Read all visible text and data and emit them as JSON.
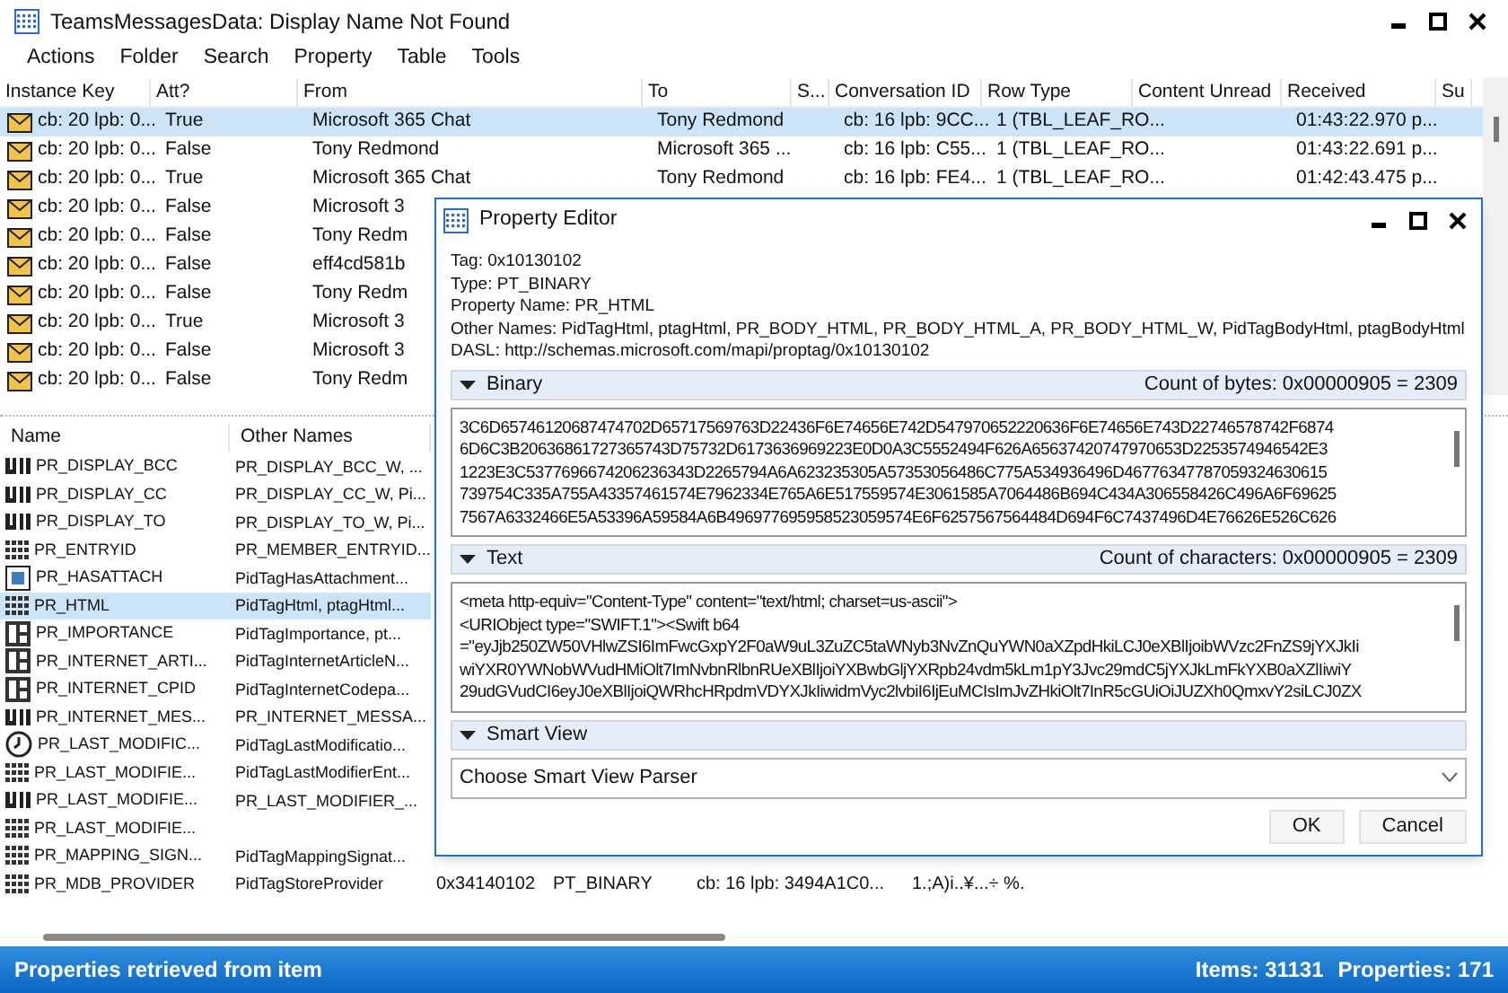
{
  "window": {
    "title": "TeamsMessagesData: Display Name Not Found"
  },
  "menu": [
    "Actions",
    "Folder",
    "Search",
    "Property",
    "Table",
    "Tools"
  ],
  "messages_table": {
    "columns": [
      "Instance Key",
      "Att?",
      "From",
      "To",
      "S...",
      "Conversation ID",
      "Row Type",
      "Content Unread",
      "Received",
      "Su"
    ],
    "rows": [
      {
        "selected": true,
        "instance_key": "cb: 20 lpb: 0...",
        "attachment": "True",
        "from": "Microsoft 365 Chat",
        "to": "Tony Redmond",
        "conversation_id": "cb: 16 lpb: 9CC...",
        "row_type": "1 (TBL_LEAF_RO...",
        "received": "01:43:22.970 p..."
      },
      {
        "selected": false,
        "instance_key": "cb: 20 lpb: 0...",
        "attachment": "False",
        "from": "Tony Redmond",
        "to": "Microsoft 365 ...",
        "conversation_id": "cb: 16 lpb: C55...",
        "row_type": "1 (TBL_LEAF_RO...",
        "received": "01:43:22.691 p..."
      },
      {
        "selected": false,
        "instance_key": "cb: 20 lpb: 0...",
        "attachment": "True",
        "from": "Microsoft 365 Chat",
        "to": "Tony Redmond",
        "conversation_id": "cb: 16 lpb: FE4...",
        "row_type": "1 (TBL_LEAF_RO...",
        "received": "01:42:43.475 p..."
      },
      {
        "selected": false,
        "instance_key": "cb: 20 lpb: 0...",
        "attachment": "False",
        "from": "Microsoft 3"
      },
      {
        "selected": false,
        "instance_key": "cb: 20 lpb: 0...",
        "attachment": "False",
        "from": "Tony Redm"
      },
      {
        "selected": false,
        "instance_key": "cb: 20 lpb: 0...",
        "attachment": "False",
        "from": "eff4cd581b"
      },
      {
        "selected": false,
        "instance_key": "cb: 20 lpb: 0...",
        "attachment": "False",
        "from": "Tony Redm"
      },
      {
        "selected": false,
        "instance_key": "cb: 20 lpb: 0...",
        "attachment": "True",
        "from": "Microsoft 3"
      },
      {
        "selected": false,
        "instance_key": "cb: 20 lpb: 0...",
        "attachment": "False",
        "from": "Microsoft 3"
      },
      {
        "selected": false,
        "instance_key": "cb: 20 lpb: 0...",
        "attachment": "False",
        "from": "Tony Redm"
      }
    ]
  },
  "properties_table": {
    "columns": [
      "Name",
      "Other Names"
    ],
    "rows": [
      {
        "kind": "unicode",
        "selected": false,
        "name": "PR_DISPLAY_BCC",
        "other_names": "PR_DISPLAY_BCC_W, ..."
      },
      {
        "kind": "unicode",
        "selected": false,
        "name": "PR_DISPLAY_CC",
        "other_names": "PR_DISPLAY_CC_W, Pi..."
      },
      {
        "kind": "unicode",
        "selected": false,
        "name": "PR_DISPLAY_TO",
        "other_names": "PR_DISPLAY_TO_W, Pi..."
      },
      {
        "kind": "binary",
        "selected": false,
        "name": "PR_ENTRYID",
        "other_names": "PR_MEMBER_ENTRYID..."
      },
      {
        "kind": "boolean",
        "selected": false,
        "name": "PR_HASATTACH",
        "other_names": "PidTagHasAttachment..."
      },
      {
        "kind": "binary",
        "selected": true,
        "name": "PR_HTML",
        "other_names": "PidTagHtml, ptagHtml..."
      },
      {
        "kind": "long",
        "selected": false,
        "name": "PR_IMPORTANCE",
        "other_names": "PidTagImportance, pt..."
      },
      {
        "kind": "long",
        "selected": false,
        "name": "PR_INTERNET_ARTI...",
        "other_names": "PidTagInternetArticleN..."
      },
      {
        "kind": "long",
        "selected": false,
        "name": "PR_INTERNET_CPID",
        "other_names": "PidTagInternetCodepa..."
      },
      {
        "kind": "unicode",
        "selected": false,
        "name": "PR_INTERNET_MES...",
        "other_names": "PR_INTERNET_MESSA..."
      },
      {
        "kind": "time",
        "selected": false,
        "name": "PR_LAST_MODIFIC...",
        "other_names": "PidTagLastModificatio..."
      },
      {
        "kind": "binary",
        "selected": false,
        "name": "PR_LAST_MODIFIE...",
        "other_names": "PidTagLastModifierEnt..."
      },
      {
        "kind": "unicode",
        "selected": false,
        "name": "PR_LAST_MODIFIE...",
        "other_names": "PR_LAST_MODIFIER_..."
      },
      {
        "kind": "binary",
        "selected": false,
        "name": "PR_LAST_MODIFIE..."
      },
      {
        "kind": "binary",
        "selected": false,
        "name": "PR_MAPPING_SIGN...",
        "other_names": "PidTagMappingSignat..."
      },
      {
        "kind": "binary",
        "selected": false,
        "name": "PR_MDB_PROVIDER",
        "other_names": "PidTagStoreProvider",
        "tag": "0x34140102",
        "prop_type": "PT_BINARY",
        "value": "cb: 16 lpb: 3494A1C0...",
        "smart_view": "1.;A)i..¥...÷ %."
      }
    ]
  },
  "dialog": {
    "title": "Property Editor",
    "info": [
      "Tag: 0x10130102",
      "Type: PT_BINARY",
      "Property Name: PR_HTML",
      "Other Names: PidTagHtml, ptagHtml, PR_BODY_HTML, PR_BODY_HTML_A, PR_BODY_HTML_W, PidTagBodyHtml, ptagBodyHtml",
      "DASL: http://schemas.microsoft.com/mapi/proptag/0x10130102"
    ],
    "sections": [
      {
        "kind": "hex",
        "label": "Binary",
        "expanded": true,
        "count": "Count of bytes: 0x00000905 = 2309",
        "lines": [
          "3C6D65746120687474702D65717569763D22436F6E74656E742D547970652220636F6E74656E743D22746578742F6874",
          "6D6C3B20636861727365743D75732D6173636969223E0D0A3C5552494F626A65637420747970653D2253574946542E3",
          "1223E3C5377696674206236343D2265794A6A623235305A57353056486C775A534936496D46776347787059324630615",
          "739754C335A755A43357461574E7962334E765A6E517559574E3061585A7064486B694C434A306558426C496A6F69625",
          "7567A6332466E5A53396A59584A6B496977695958523059574E6F6257567564484D694F6C7437496D4E76626E526C626"
        ]
      },
      {
        "kind": "text",
        "label": "Text",
        "expanded": true,
        "count": "Count of characters: 0x00000905 = 2309",
        "lines": [
          "<meta http-equiv=\"Content-Type\" content=\"text/html; charset=us-ascii\">",
          "<URIObject type=\"SWIFT.1\"><Swift b64",
          "=\"eyJjb250ZW50VHlwZSI6ImFwcGxpY2F0aW9uL3ZuZC5taWNyb3NvZnQuYWN0aXZpdHkiLCJ0eXBlIjoibWVzc2FnZS9jYXJkIi",
          "wiYXR0YWNobWVudHMiOlt7ImNvbnRlbnRUeXBlIjoiYXBwbGljYXRpb24vdm5kLm1pY3Jvc29mdC5jYXJkLmFkYXB0aXZlIiwiY",
          "29udGVudCI6eyJ0eXBlIjoiQWRhcHRpdmVDYXJkIiwidmVyc2lvbiI6IjEuMCIsImJvZHkiOlt7InR5cGUiOiJUZXh0QmxvY2siLCJ0ZX"
        ]
      },
      {
        "kind": "select",
        "label": "Smart View",
        "expanded": true,
        "value": "Choose Smart View Parser"
      }
    ],
    "buttons": [
      "OK",
      "Cancel"
    ]
  },
  "status_bar": {
    "message": "Properties retrieved from item",
    "items": "Items: 31131",
    "properties": "Properties: 171"
  }
}
